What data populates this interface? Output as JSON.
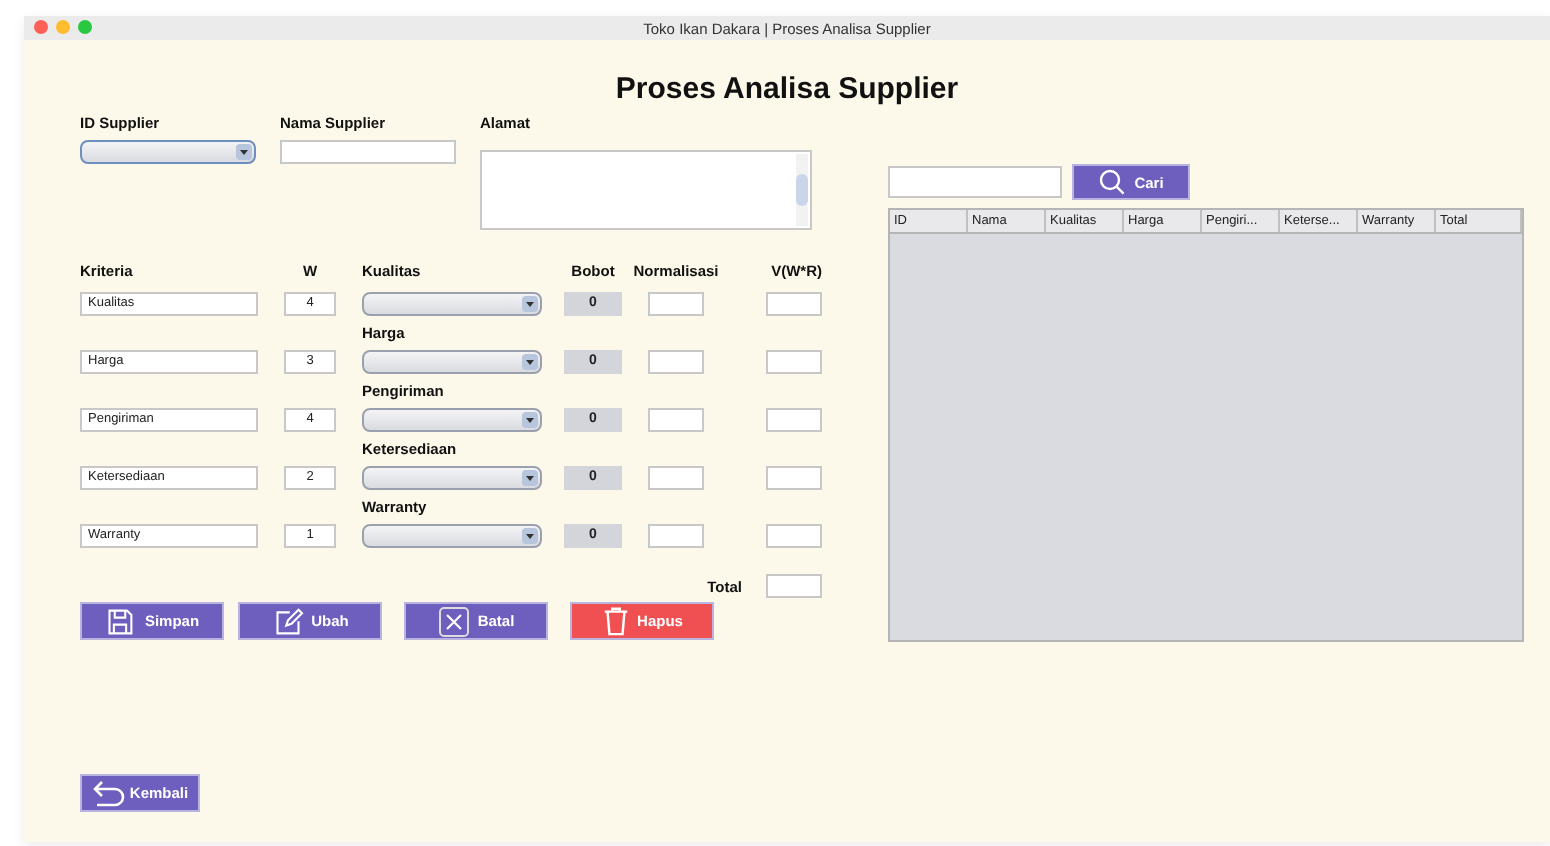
{
  "window": {
    "title": "Toko Ikan Dakara | Proses Analisa Supplier"
  },
  "heading": "Proses Analisa Supplier",
  "supplier": {
    "id_label": "ID Supplier",
    "name_label": "Nama Supplier",
    "address_label": "Alamat"
  },
  "criteria_header": {
    "kriteria": "Kriteria",
    "w": "W",
    "bobot": "Bobot",
    "normalisasi": "Normalisasi",
    "v": "V(W*R)"
  },
  "criteria": [
    {
      "name": "Kualitas",
      "w": "4",
      "selector_label": "Kualitas",
      "bobot": "0"
    },
    {
      "name": "Harga",
      "w": "3",
      "selector_label": "Harga",
      "bobot": "0"
    },
    {
      "name": "Pengiriman",
      "w": "4",
      "selector_label": "Pengiriman",
      "bobot": "0"
    },
    {
      "name": "Ketersediaan",
      "w": "2",
      "selector_label": "Ketersediaan",
      "bobot": "0"
    },
    {
      "name": "Warranty",
      "w": "1",
      "selector_label": "Warranty",
      "bobot": "0"
    }
  ],
  "total_label": "Total",
  "buttons": [
    {
      "label": "Simpan",
      "kind": "save"
    },
    {
      "label": "Ubah",
      "kind": "edit"
    },
    {
      "label": "Batal",
      "kind": "cancel"
    },
    {
      "label": "Hapus",
      "kind": "delete"
    }
  ],
  "back_button": "Kembali",
  "search": {
    "button": "Cari"
  },
  "table": {
    "columns": [
      "ID",
      "Nama",
      "Kualitas",
      "Harga",
      "Pengiri...",
      "Keterse...",
      "Warranty",
      "Total"
    ]
  }
}
